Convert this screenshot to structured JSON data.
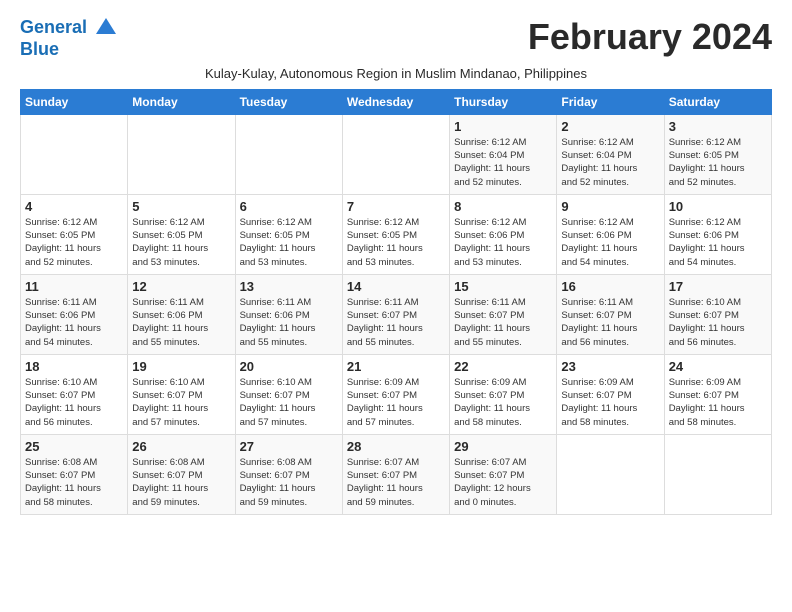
{
  "header": {
    "logo_line1": "General",
    "logo_line2": "Blue",
    "month_title": "February 2024",
    "subtitle": "Kulay-Kulay, Autonomous Region in Muslim Mindanao, Philippines"
  },
  "days_of_week": [
    "Sunday",
    "Monday",
    "Tuesday",
    "Wednesday",
    "Thursday",
    "Friday",
    "Saturday"
  ],
  "weeks": [
    [
      {
        "day": "",
        "info": ""
      },
      {
        "day": "",
        "info": ""
      },
      {
        "day": "",
        "info": ""
      },
      {
        "day": "",
        "info": ""
      },
      {
        "day": "1",
        "info": "Sunrise: 6:12 AM\nSunset: 6:04 PM\nDaylight: 11 hours\nand 52 minutes."
      },
      {
        "day": "2",
        "info": "Sunrise: 6:12 AM\nSunset: 6:04 PM\nDaylight: 11 hours\nand 52 minutes."
      },
      {
        "day": "3",
        "info": "Sunrise: 6:12 AM\nSunset: 6:05 PM\nDaylight: 11 hours\nand 52 minutes."
      }
    ],
    [
      {
        "day": "4",
        "info": "Sunrise: 6:12 AM\nSunset: 6:05 PM\nDaylight: 11 hours\nand 52 minutes."
      },
      {
        "day": "5",
        "info": "Sunrise: 6:12 AM\nSunset: 6:05 PM\nDaylight: 11 hours\nand 53 minutes."
      },
      {
        "day": "6",
        "info": "Sunrise: 6:12 AM\nSunset: 6:05 PM\nDaylight: 11 hours\nand 53 minutes."
      },
      {
        "day": "7",
        "info": "Sunrise: 6:12 AM\nSunset: 6:05 PM\nDaylight: 11 hours\nand 53 minutes."
      },
      {
        "day": "8",
        "info": "Sunrise: 6:12 AM\nSunset: 6:06 PM\nDaylight: 11 hours\nand 53 minutes."
      },
      {
        "day": "9",
        "info": "Sunrise: 6:12 AM\nSunset: 6:06 PM\nDaylight: 11 hours\nand 54 minutes."
      },
      {
        "day": "10",
        "info": "Sunrise: 6:12 AM\nSunset: 6:06 PM\nDaylight: 11 hours\nand 54 minutes."
      }
    ],
    [
      {
        "day": "11",
        "info": "Sunrise: 6:11 AM\nSunset: 6:06 PM\nDaylight: 11 hours\nand 54 minutes."
      },
      {
        "day": "12",
        "info": "Sunrise: 6:11 AM\nSunset: 6:06 PM\nDaylight: 11 hours\nand 55 minutes."
      },
      {
        "day": "13",
        "info": "Sunrise: 6:11 AM\nSunset: 6:06 PM\nDaylight: 11 hours\nand 55 minutes."
      },
      {
        "day": "14",
        "info": "Sunrise: 6:11 AM\nSunset: 6:07 PM\nDaylight: 11 hours\nand 55 minutes."
      },
      {
        "day": "15",
        "info": "Sunrise: 6:11 AM\nSunset: 6:07 PM\nDaylight: 11 hours\nand 55 minutes."
      },
      {
        "day": "16",
        "info": "Sunrise: 6:11 AM\nSunset: 6:07 PM\nDaylight: 11 hours\nand 56 minutes."
      },
      {
        "day": "17",
        "info": "Sunrise: 6:10 AM\nSunset: 6:07 PM\nDaylight: 11 hours\nand 56 minutes."
      }
    ],
    [
      {
        "day": "18",
        "info": "Sunrise: 6:10 AM\nSunset: 6:07 PM\nDaylight: 11 hours\nand 56 minutes."
      },
      {
        "day": "19",
        "info": "Sunrise: 6:10 AM\nSunset: 6:07 PM\nDaylight: 11 hours\nand 57 minutes."
      },
      {
        "day": "20",
        "info": "Sunrise: 6:10 AM\nSunset: 6:07 PM\nDaylight: 11 hours\nand 57 minutes."
      },
      {
        "day": "21",
        "info": "Sunrise: 6:09 AM\nSunset: 6:07 PM\nDaylight: 11 hours\nand 57 minutes."
      },
      {
        "day": "22",
        "info": "Sunrise: 6:09 AM\nSunset: 6:07 PM\nDaylight: 11 hours\nand 58 minutes."
      },
      {
        "day": "23",
        "info": "Sunrise: 6:09 AM\nSunset: 6:07 PM\nDaylight: 11 hours\nand 58 minutes."
      },
      {
        "day": "24",
        "info": "Sunrise: 6:09 AM\nSunset: 6:07 PM\nDaylight: 11 hours\nand 58 minutes."
      }
    ],
    [
      {
        "day": "25",
        "info": "Sunrise: 6:08 AM\nSunset: 6:07 PM\nDaylight: 11 hours\nand 58 minutes."
      },
      {
        "day": "26",
        "info": "Sunrise: 6:08 AM\nSunset: 6:07 PM\nDaylight: 11 hours\nand 59 minutes."
      },
      {
        "day": "27",
        "info": "Sunrise: 6:08 AM\nSunset: 6:07 PM\nDaylight: 11 hours\nand 59 minutes."
      },
      {
        "day": "28",
        "info": "Sunrise: 6:07 AM\nSunset: 6:07 PM\nDaylight: 11 hours\nand 59 minutes."
      },
      {
        "day": "29",
        "info": "Sunrise: 6:07 AM\nSunset: 6:07 PM\nDaylight: 12 hours\nand 0 minutes."
      },
      {
        "day": "",
        "info": ""
      },
      {
        "day": "",
        "info": ""
      }
    ]
  ]
}
